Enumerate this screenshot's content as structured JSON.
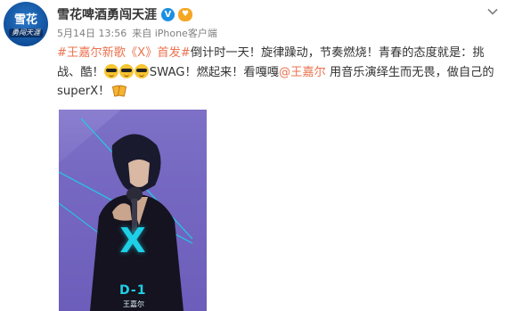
{
  "post": {
    "avatar": {
      "text_top": "雪花",
      "text_bottom": "勇闯天涯"
    },
    "username": "雪花啤酒勇闯天涯",
    "verified_label": "V",
    "timestamp": "5月14日 13:56",
    "source": "来自 iPhone客户端",
    "content": {
      "hashtag": "#王嘉尔新歌《X》首发#",
      "text1": "倒计时一天！旋律躁动，节奏燃烧！青春的态度就是：挑战、酷！",
      "text2": "SWAG！燃起来！看嘎嘎",
      "mention": "@王嘉尔",
      "text3": " 用音乐演绎生而无畏，做自己的superX！"
    },
    "image": {
      "big_x": "X",
      "countdown": "D-1",
      "artist": "王嘉尔"
    }
  },
  "colors": {
    "link": "#eb7350",
    "verified": "#1a8fe3",
    "poster": "#7a6ec5",
    "neon": "#1ecfe6"
  },
  "icons": [
    "chevron-down-icon",
    "verified-icon",
    "fans-badge-icon",
    "cool-emoji-icon",
    "cheers-emoji-icon"
  ]
}
